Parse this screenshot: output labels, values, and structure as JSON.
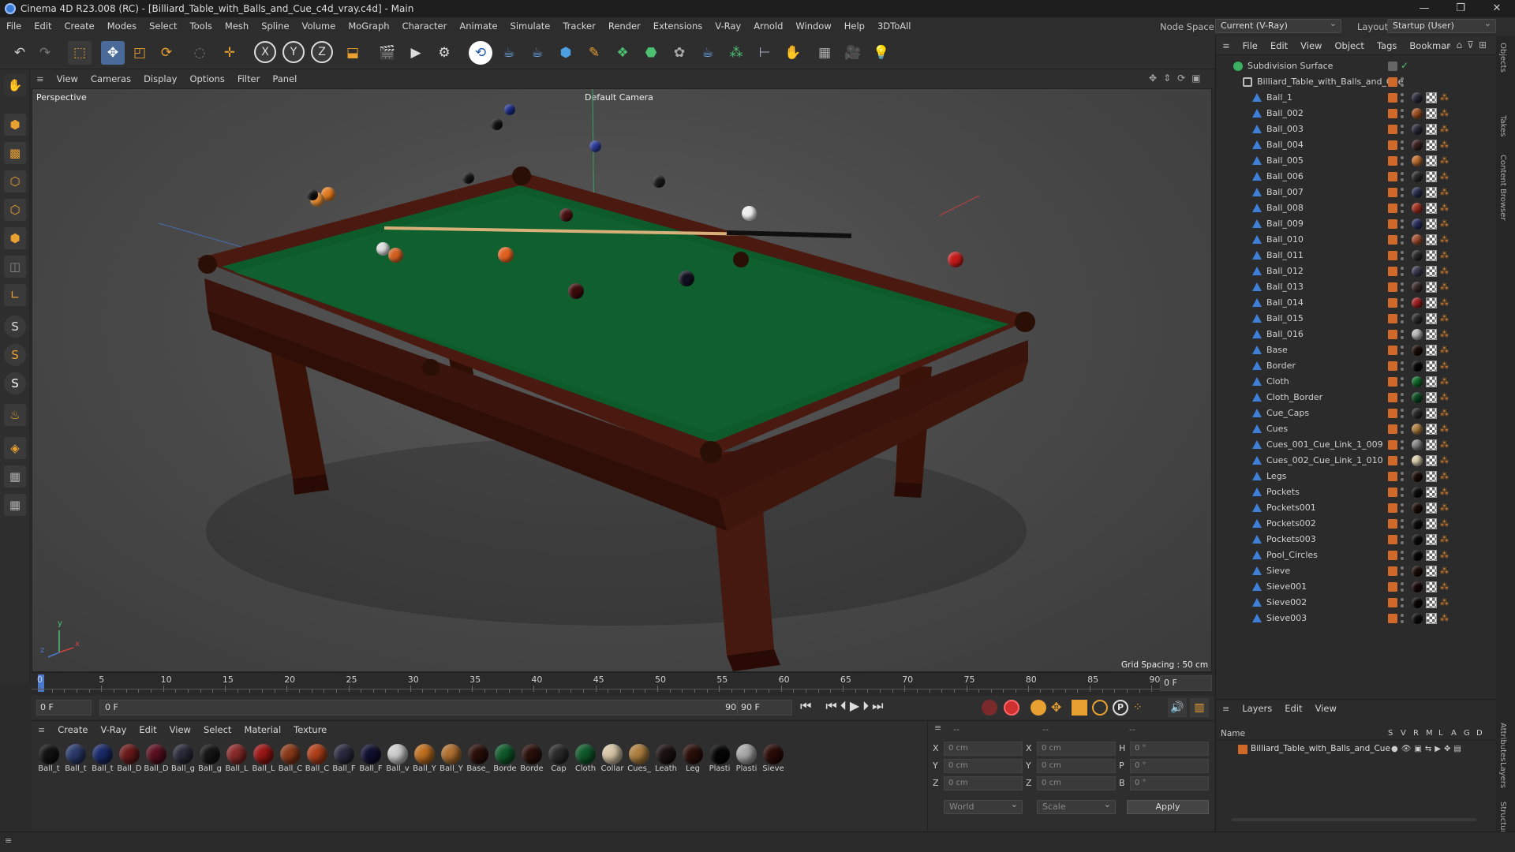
{
  "window": {
    "title": "Cinema 4D R23.008 (RC) - [Billiard_Table_with_Balls_and_Cue_c4d_vray.c4d] - Main",
    "minimize": "—",
    "maximize": "❐",
    "close": "✕"
  },
  "menubar": {
    "items": [
      "File",
      "Edit",
      "Create",
      "Modes",
      "Select",
      "Tools",
      "Mesh",
      "Spline",
      "Volume",
      "MoGraph",
      "Character",
      "Animate",
      "Simulate",
      "Tracker",
      "Render",
      "Extensions",
      "V-Ray",
      "Arnold",
      "Window",
      "Help",
      "3DToAll"
    ],
    "node_space_label": "Node Space:",
    "node_space_value": "Current (V-Ray)",
    "layout_label": "Layout:",
    "layout_value": "Startup (User)"
  },
  "viewport": {
    "menu": [
      "View",
      "Cameras",
      "Display",
      "Options",
      "Filter",
      "Panel"
    ],
    "view_name": "Perspective",
    "camera_name": "Default Camera",
    "grid_spacing": "Grid Spacing : 50 cm",
    "axis_y": "y",
    "axis_x": "x",
    "axis_z": "z"
  },
  "timeline": {
    "ticks": [
      "0",
      "5",
      "10",
      "15",
      "20",
      "25",
      "30",
      "35",
      "40",
      "45",
      "50",
      "55",
      "60",
      "65",
      "70",
      "75",
      "80",
      "85",
      "90"
    ],
    "current_frame": "0 F"
  },
  "transport": {
    "start_field": "0 F",
    "range_start": "0 F",
    "range_end": "90 F",
    "end_field": "90 F"
  },
  "materials": {
    "menu": [
      "Create",
      "V-Ray",
      "Edit",
      "View",
      "Select",
      "Material",
      "Texture"
    ],
    "items": [
      {
        "label": "Ball_t",
        "color": "#111111"
      },
      {
        "label": "Ball_t",
        "color": "#2a3a6a"
      },
      {
        "label": "Ball_t",
        "color": "#1a2a6a"
      },
      {
        "label": "Ball_D",
        "color": "#6a1a1a"
      },
      {
        "label": "Ball_D",
        "color": "#5a1020"
      },
      {
        "label": "Ball_g",
        "color": "#2a2a3a"
      },
      {
        "label": "Ball_g",
        "color": "#151515"
      },
      {
        "label": "Ball_L",
        "color": "#8a2a2a"
      },
      {
        "label": "Ball_L",
        "color": "#9a1515"
      },
      {
        "label": "Ball_C",
        "color": "#8a3a1a"
      },
      {
        "label": "Ball_C",
        "color": "#b0401a"
      },
      {
        "label": "Ball_F",
        "color": "#2a2a40"
      },
      {
        "label": "Ball_F",
        "color": "#101030"
      },
      {
        "label": "Ball_v",
        "color": "#cfcfcf"
      },
      {
        "label": "Ball_Y",
        "color": "#c07020"
      },
      {
        "label": "Ball_Y",
        "color": "#b07030"
      },
      {
        "label": "Base_",
        "color": "#2a0f0a"
      },
      {
        "label": "Borde",
        "color": "#0f5a2a"
      },
      {
        "label": "Borde",
        "color": "#2a0f0a"
      },
      {
        "label": "Cap",
        "color": "#2a2a2a"
      },
      {
        "label": "Cloth",
        "color": "#0f5a2a"
      },
      {
        "label": "Collar",
        "color": "#d8c8a8"
      },
      {
        "label": "Cues_",
        "color": "#b08040"
      },
      {
        "label": "Leath",
        "color": "#1a1010"
      },
      {
        "label": "Leg",
        "color": "#2a0f0a"
      },
      {
        "label": "Plasti",
        "color": "#050505"
      },
      {
        "label": "Plasti",
        "color": "#aaaaaa"
      },
      {
        "label": "Sieve",
        "color": "#2a0a05"
      }
    ]
  },
  "coords": {
    "x_label": "X",
    "y_label": "Y",
    "z_label": "Z",
    "pos_x": "0 cm",
    "pos_y": "0 cm",
    "pos_z": "0 cm",
    "size_x_label": "X",
    "size_y_label": "Y",
    "size_z_label": "Z",
    "size_x": "0 cm",
    "size_y": "0 cm",
    "size_z": "0 cm",
    "h_label": "H",
    "p_label": "P",
    "b_label": "B",
    "rot_h": "0 °",
    "rot_p": "0 °",
    "rot_b": "0 °",
    "header1": "--",
    "header2": "--",
    "header3": "--",
    "mode_world": "World",
    "mode_scale": "Scale",
    "apply": "Apply"
  },
  "objects": {
    "menu": [
      "File",
      "Edit",
      "View",
      "Object",
      "Tags",
      "Bookmar"
    ],
    "root": "Subdivision Surface",
    "group": "Billiard_Table_with_Balls_and_Cue",
    "items": [
      {
        "name": "Ball_1",
        "mat": "#2a2a3a"
      },
      {
        "name": "Ball_002",
        "mat": "#a05020"
      },
      {
        "name": "Ball_003",
        "mat": "#2a2a3a"
      },
      {
        "name": "Ball_004",
        "mat": "#3a2020"
      },
      {
        "name": "Ball_005",
        "mat": "#c07030"
      },
      {
        "name": "Ball_006",
        "mat": "#2a2a2a"
      },
      {
        "name": "Ball_007",
        "mat": "#2a3050"
      },
      {
        "name": "Ball_008",
        "mat": "#a03020"
      },
      {
        "name": "Ball_009",
        "mat": "#2a3060"
      },
      {
        "name": "Ball_010",
        "mat": "#a05030"
      },
      {
        "name": "Ball_011",
        "mat": "#2a2a2a"
      },
      {
        "name": "Ball_012",
        "mat": "#3a3a50"
      },
      {
        "name": "Ball_013",
        "mat": "#3a2a2a"
      },
      {
        "name": "Ball_014",
        "mat": "#a02020"
      },
      {
        "name": "Ball_015",
        "mat": "#2a2a2a"
      },
      {
        "name": "Ball_016",
        "mat": "#bbbbbb"
      },
      {
        "name": "Base",
        "mat": "#1a0a05"
      },
      {
        "name": "Border",
        "mat": "#050505"
      },
      {
        "name": "Cloth",
        "mat": "#0f6a2a"
      },
      {
        "name": "Cloth_Border",
        "mat": "#0a4a20"
      },
      {
        "name": "Cue_Caps",
        "mat": "#2a2a2a"
      },
      {
        "name": "Cues",
        "mat": "#b08040"
      },
      {
        "name": "Cues_001_Cue_Link_1_009",
        "mat": "#888888"
      },
      {
        "name": "Cues_002_Cue_Link_1_010",
        "mat": "#ddd0b0"
      },
      {
        "name": "Legs",
        "mat": "#1a0a05"
      },
      {
        "name": "Pockets",
        "mat": "#0a0a0a"
      },
      {
        "name": "Pockets001",
        "mat": "#1a0a05"
      },
      {
        "name": "Pockets002",
        "mat": "#0a0a0a"
      },
      {
        "name": "Pockets003",
        "mat": "#0a0a0a"
      },
      {
        "name": "Pool_Circles",
        "mat": "#050505"
      },
      {
        "name": "Sieve",
        "mat": "#1a0a05"
      },
      {
        "name": "Sieve001",
        "mat": "#150505"
      },
      {
        "name": "Sieve002",
        "mat": "#0a0505"
      },
      {
        "name": "Sieve003",
        "mat": "#0a0a0a"
      }
    ]
  },
  "layers": {
    "menu": [
      "Layers",
      "Edit",
      "View"
    ],
    "col_name": "Name",
    "cols": [
      "S",
      "V",
      "R",
      "M",
      "L",
      "A",
      "G",
      "D"
    ],
    "row": "Billiard_Table_with_Balls_and_Cue"
  },
  "sidetabs": [
    "Objects",
    "Takes",
    "Content Browser",
    "Attributes",
    "Layers",
    "Structure"
  ],
  "colors": {
    "accent": "#3f7fd8",
    "orange": "#d0682a",
    "felt": "#0d5a2a",
    "wood": "#3a140c"
  }
}
